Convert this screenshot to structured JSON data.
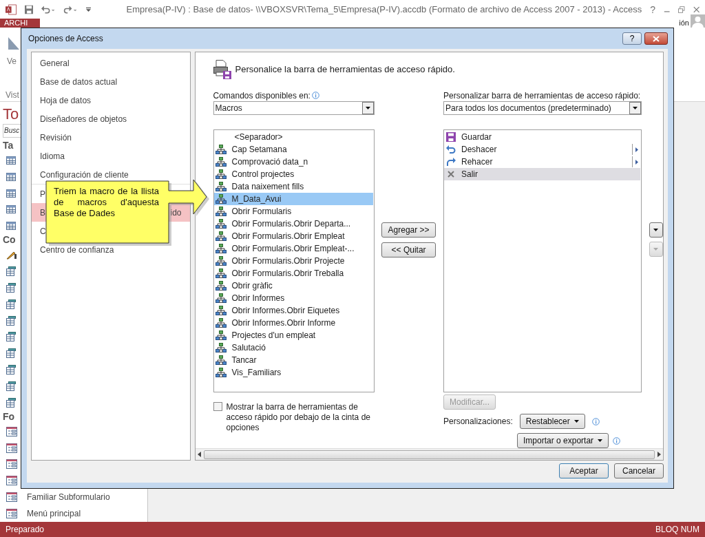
{
  "app": {
    "title": "Empresa(P-IV) : Base de datos- \\\\VBOXSVR\\Tema_5\\Empresa(P-IV).accdb (Formato de archivo de Access 2007 - 2013) - Access",
    "help": "?",
    "file_tab": "ARCHI",
    "sign_in": "ión",
    "ribbon_button": "Ve",
    "ribbon_group": "Vist"
  },
  "navigation": {
    "title": "To",
    "search": {
      "placeholder": "Busc"
    },
    "groups": [
      {
        "header": "Ta",
        "items": [
          {
            "kind": "table"
          },
          {
            "kind": "table"
          },
          {
            "kind": "table"
          },
          {
            "kind": "table"
          },
          {
            "kind": "table"
          }
        ]
      },
      {
        "header": "Co",
        "items": [
          {
            "kind": "design"
          },
          {
            "kind": "query"
          },
          {
            "kind": "query"
          },
          {
            "kind": "query"
          },
          {
            "kind": "query"
          },
          {
            "kind": "query"
          },
          {
            "kind": "query"
          },
          {
            "kind": "query"
          },
          {
            "kind": "query"
          },
          {
            "kind": "query"
          }
        ]
      },
      {
        "header": "Fo",
        "items": [
          {
            "kind": "form"
          },
          {
            "kind": "form"
          },
          {
            "kind": "form"
          },
          {
            "kind": "form"
          },
          {
            "kind": "form",
            "label": "Familiar Subformulario"
          },
          {
            "kind": "form",
            "label": "Menú principal"
          }
        ]
      }
    ]
  },
  "status_bar": {
    "left": "Preparado",
    "right": "BLOQ NUM"
  },
  "dialog": {
    "title": "Opciones de Access",
    "help": "?",
    "sections": [
      {
        "items": [
          {
            "label": "General",
            "selected": false
          },
          {
            "label": "Base de datos actual",
            "selected": false
          },
          {
            "label": "Hoja de datos",
            "selected": false
          },
          {
            "label": "Diseñadores de objetos",
            "selected": false
          },
          {
            "label": "Revisión",
            "selected": false
          },
          {
            "label": "Idioma",
            "selected": false
          },
          {
            "label": "Configuración de cliente",
            "selected": false
          }
        ]
      },
      {
        "items": [
          {
            "label": "P",
            "selected": false
          },
          {
            "label": "B",
            "tail": "ido",
            "selected": true
          },
          {
            "label": "C",
            "selected": false
          },
          {
            "label": "Centro de confianza",
            "selected": false
          }
        ]
      }
    ],
    "heading": "Personalice la barra de herramientas de acceso rápido.",
    "commands": {
      "label": "Comandos disponibles en:",
      "select": "Macros",
      "items": [
        {
          "kind": "separator",
          "label": "<Separador>",
          "selected": false
        },
        {
          "kind": "macro",
          "label": "Cap Setamana",
          "selected": false
        },
        {
          "kind": "macro",
          "label": "Comprovació data_n",
          "selected": false
        },
        {
          "kind": "macro",
          "label": "Control projectes",
          "selected": false
        },
        {
          "kind": "macro",
          "label": "Data naixement fills",
          "selected": false
        },
        {
          "kind": "macro",
          "label": "M_Data_Avui",
          "selected": true
        },
        {
          "kind": "macro",
          "label": "Obrir Formularis",
          "selected": false
        },
        {
          "kind": "macro",
          "label": "Obrir Formularis.Obrir Departa...",
          "selected": false
        },
        {
          "kind": "macro",
          "label": "Obrir Formularis.Obrir Empleat",
          "selected": false
        },
        {
          "kind": "macro",
          "label": "Obrir Formularis.Obrir Empleat-...",
          "selected": false
        },
        {
          "kind": "macro",
          "label": "Obrir Formularis.Obrir Projecte",
          "selected": false
        },
        {
          "kind": "macro",
          "label": "Obrir Formularis.Obrir Treballa",
          "selected": false
        },
        {
          "kind": "macro",
          "label": "Obrir gràfic",
          "selected": false
        },
        {
          "kind": "macro",
          "label": "Obrir Informes",
          "selected": false
        },
        {
          "kind": "macro",
          "label": "Obrir Informes.Obrir Eiquetes",
          "selected": false
        },
        {
          "kind": "macro",
          "label": "Obrir Informes.Obrir Informe",
          "selected": false
        },
        {
          "kind": "macro",
          "label": "Projectes d'un empleat",
          "selected": false
        },
        {
          "kind": "macro",
          "label": "Salutació",
          "selected": false
        },
        {
          "kind": "macro",
          "label": "Tancar",
          "selected": false
        },
        {
          "kind": "macro",
          "label": "Vis_Familiars",
          "selected": false
        }
      ]
    },
    "toolbar": {
      "label": "Personalizar barra de herramientas de acceso rápido:",
      "select": "Para todos los documentos (predeterminado)",
      "items": [
        {
          "kind": "save",
          "label": "Guardar",
          "submenu": false,
          "selected": false
        },
        {
          "kind": "undo",
          "label": "Deshacer",
          "submenu": true,
          "selected": false
        },
        {
          "kind": "redo",
          "label": "Rehacer",
          "submenu": true,
          "selected": false
        },
        {
          "kind": "exit",
          "label": "Salir",
          "submenu": false,
          "selected": true
        }
      ]
    },
    "add_button": "Agregar >>",
    "remove_button": "<< Quitar",
    "modify_button": {
      "label": "Modificar...",
      "disabled": true
    },
    "show_below": {
      "label": "Mostrar la barra de herramientas de acceso rápido por debajo de la cinta de opciones",
      "checked": false
    },
    "customizations": {
      "label": "Personalizaciones:",
      "reset": "Restablecer",
      "import_export": "Importar o exportar"
    },
    "ok": "Aceptar",
    "cancel": "Cancelar"
  },
  "callout": {
    "text": "Triem la macro de la llista de macros d'aquesta Base de Dades"
  }
}
